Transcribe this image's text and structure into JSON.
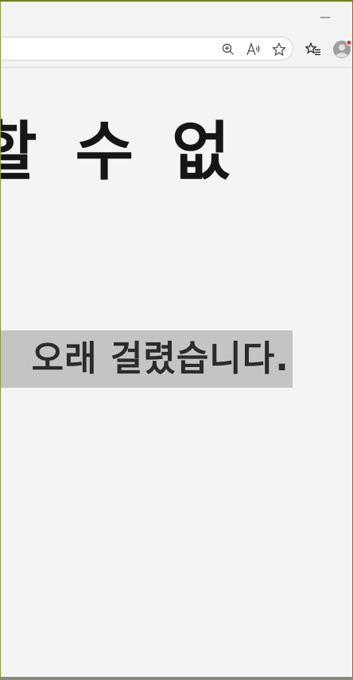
{
  "window": {
    "minimize_glyph": "—"
  },
  "toolbar": {
    "icons": [
      "zoom-in-icon",
      "read-aloud-icon",
      "favorite-star-icon",
      "favorites-list-icon",
      "profile-avatar-icon"
    ],
    "notification_dot_color": "#d32f2f"
  },
  "page": {
    "heading": "할 수 없",
    "subtext": "오래 걸렸습니다."
  }
}
